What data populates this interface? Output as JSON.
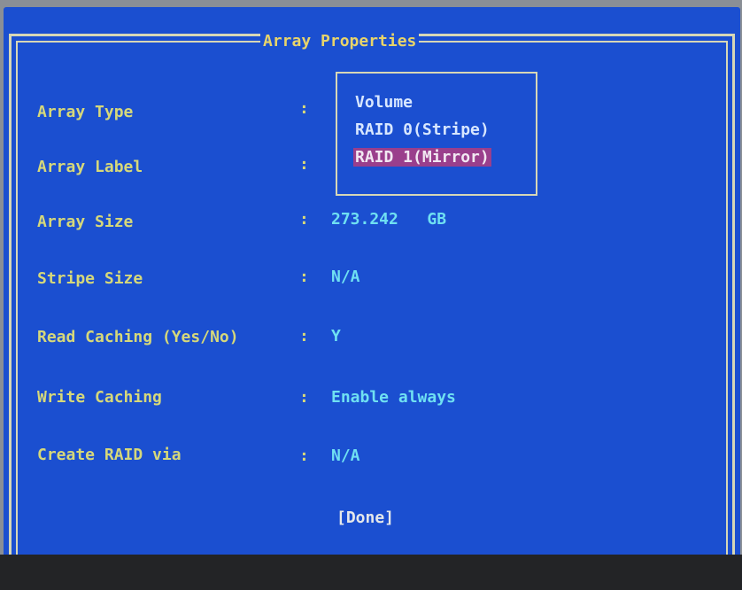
{
  "window": {
    "title": "Array Properties"
  },
  "fields": [
    {
      "label": "Array Type",
      "colon": ":",
      "value": ""
    },
    {
      "label": "Array Label",
      "colon": ":",
      "value": ""
    },
    {
      "label": "Array Size",
      "colon": ":",
      "value": "273.242   GB"
    },
    {
      "label": "Stripe Size",
      "colon": ":",
      "value": "N/A"
    },
    {
      "label": "Read Caching (Yes/No)",
      "colon": ":",
      "value": "Y"
    },
    {
      "label": "Write Caching",
      "colon": ":",
      "value": "Enable always"
    },
    {
      "label": "Create RAID via",
      "colon": ":",
      "value": "N/A"
    }
  ],
  "array_type_options": [
    {
      "label": "Volume",
      "selected": false
    },
    {
      "label": "RAID 0(Stripe)",
      "selected": false
    },
    {
      "label": "RAID 1(Mirror)",
      "selected": true
    }
  ],
  "done_button": {
    "label": "[Done]"
  },
  "colors": {
    "background": "#1b4fd0",
    "label": "#d6d87a",
    "value": "#6fe0f2",
    "title": "#e8d46a",
    "selection": "#9a3f8c"
  }
}
